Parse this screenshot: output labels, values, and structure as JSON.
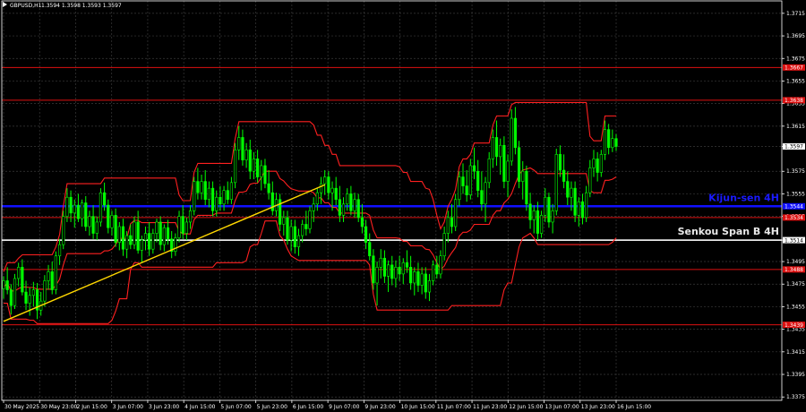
{
  "header": {
    "symbol": "GBPUSD,H1",
    "quote": "1.3594 1.3598 1.3593 1.3597"
  },
  "colors": {
    "background": "#000000",
    "grid": "#3a3a3a",
    "axis": "#ffffff",
    "candle": "#00ff00",
    "ichimoku": "#ff2020",
    "level": "#dd1010",
    "kijun_4h": "#1010ff",
    "senkou_4h": "#e8e8e8",
    "trendline": "#ffd700"
  },
  "chart_data": {
    "type": "candlestick",
    "symbol": "GBPUSD",
    "timeframe": "H1",
    "y_ticks": [
      "1.3715",
      "1.3695",
      "1.3675",
      "1.3655",
      "1.3635",
      "1.3615",
      "1.3597",
      "1.3575",
      "1.3555",
      "1.3535",
      "1.3514",
      "1.3495",
      "1.3475",
      "1.3455",
      "1.3435",
      "1.3415",
      "1.3395",
      "1.3375"
    ],
    "x_ticks": [
      "30 May 2025",
      "30 May 23:00",
      "2 Jun 15:00",
      "3 Jun 07:00",
      "3 Jun 23:00",
      "4 Jun 15:00",
      "5 Jun 07:00",
      "5 Jun 23:00",
      "6 Jun 15:00",
      "9 Jun 07:00",
      "9 Jun 23:00",
      "10 Jun 15:00",
      "11 Jun 07:00",
      "11 Jun 23:00",
      "12 Jun 15:00",
      "13 Jun 07:00",
      "13 Jun 23:00",
      "16 Jun 15:00"
    ],
    "ylim": [
      1.3372,
      1.3726
    ],
    "current_price": "1.3597",
    "levels": [
      {
        "price": 1.3667,
        "label": "1.3667",
        "kind": "support-resistance"
      },
      {
        "price": 1.3638,
        "label": "1.3638",
        "kind": "support-resistance"
      },
      {
        "price": 1.3544,
        "label": "1.3544",
        "kind": "kijun-4h",
        "name": "Kijun-sen 4H"
      },
      {
        "price": 1.3534,
        "label": "1.3534",
        "kind": "support-resistance"
      },
      {
        "price": 1.3514,
        "label": "1.3514",
        "kind": "senkou-b-4h",
        "name": "Senkou Span B 4H"
      },
      {
        "price": 1.3488,
        "label": "1.3488",
        "kind": "support-resistance"
      },
      {
        "price": 1.3439,
        "label": "1.3439",
        "kind": "support-resistance"
      }
    ],
    "trendline": {
      "from": {
        "bar": 0,
        "price": 1.3442
      },
      "to": {
        "bar": 86,
        "price": 1.3563
      }
    },
    "candles": [
      [
        1.3471,
        1.3482,
        1.3462,
        1.3478
      ],
      [
        1.3478,
        1.349,
        1.3466,
        1.347
      ],
      [
        1.347,
        1.3475,
        1.3448,
        1.3456
      ],
      [
        1.3456,
        1.3484,
        1.3453,
        1.348
      ],
      [
        1.348,
        1.3494,
        1.3473,
        1.349
      ],
      [
        1.349,
        1.3497,
        1.3465,
        1.3468
      ],
      [
        1.3468,
        1.3478,
        1.3452,
        1.3458
      ],
      [
        1.3458,
        1.3472,
        1.3447,
        1.3465
      ],
      [
        1.3465,
        1.3477,
        1.3455,
        1.347
      ],
      [
        1.347,
        1.3476,
        1.3444,
        1.3452
      ],
      [
        1.3452,
        1.3468,
        1.3447,
        1.346
      ],
      [
        1.346,
        1.3483,
        1.3455,
        1.3478
      ],
      [
        1.3478,
        1.3492,
        1.347,
        1.3486
      ],
      [
        1.3486,
        1.3495,
        1.3466,
        1.347
      ],
      [
        1.347,
        1.3504,
        1.3466,
        1.35
      ],
      [
        1.35,
        1.3515,
        1.3492,
        1.351
      ],
      [
        1.351,
        1.354,
        1.3506,
        1.3535
      ],
      [
        1.3535,
        1.356,
        1.353,
        1.3552
      ],
      [
        1.3552,
        1.3558,
        1.353,
        1.3538
      ],
      [
        1.3538,
        1.355,
        1.3525,
        1.3545
      ],
      [
        1.3545,
        1.3555,
        1.353,
        1.3533
      ],
      [
        1.3533,
        1.355,
        1.3526,
        1.3547
      ],
      [
        1.3547,
        1.3553,
        1.3522,
        1.3526
      ],
      [
        1.3526,
        1.354,
        1.3518,
        1.3535
      ],
      [
        1.3535,
        1.3545,
        1.3515,
        1.352
      ],
      [
        1.352,
        1.3535,
        1.3514,
        1.353
      ],
      [
        1.353,
        1.356,
        1.3526,
        1.3556
      ],
      [
        1.3556,
        1.3565,
        1.354,
        1.3545
      ],
      [
        1.3545,
        1.355,
        1.352,
        1.3525
      ],
      [
        1.3525,
        1.354,
        1.3518,
        1.3536
      ],
      [
        1.3536,
        1.3542,
        1.3508,
        1.3512
      ],
      [
        1.3512,
        1.353,
        1.3505,
        1.3526
      ],
      [
        1.3526,
        1.3533,
        1.35,
        1.3506
      ],
      [
        1.3506,
        1.3522,
        1.3498,
        1.3518
      ],
      [
        1.3518,
        1.3528,
        1.3506,
        1.351
      ],
      [
        1.351,
        1.3535,
        1.3506,
        1.353
      ],
      [
        1.353,
        1.354,
        1.3502,
        1.3505
      ],
      [
        1.3505,
        1.3518,
        1.3494,
        1.3514
      ],
      [
        1.3514,
        1.3526,
        1.3505,
        1.352
      ],
      [
        1.352,
        1.353,
        1.35,
        1.3506
      ],
      [
        1.3506,
        1.3524,
        1.3502,
        1.352
      ],
      [
        1.352,
        1.3533,
        1.3512,
        1.353
      ],
      [
        1.353,
        1.3535,
        1.3505,
        1.351
      ],
      [
        1.351,
        1.3528,
        1.3504,
        1.3525
      ],
      [
        1.3525,
        1.3532,
        1.351,
        1.3515
      ],
      [
        1.3515,
        1.3522,
        1.3498,
        1.3504
      ],
      [
        1.3504,
        1.352,
        1.35,
        1.3516
      ],
      [
        1.3516,
        1.354,
        1.3512,
        1.3535
      ],
      [
        1.3535,
        1.3545,
        1.3515,
        1.352
      ],
      [
        1.352,
        1.3534,
        1.3514,
        1.353
      ],
      [
        1.353,
        1.3545,
        1.3524,
        1.354
      ],
      [
        1.354,
        1.357,
        1.3536,
        1.3566
      ],
      [
        1.3566,
        1.3578,
        1.355,
        1.3556
      ],
      [
        1.3556,
        1.3572,
        1.355,
        1.3566
      ],
      [
        1.3566,
        1.3576,
        1.3545,
        1.355
      ],
      [
        1.355,
        1.3566,
        1.3543,
        1.356
      ],
      [
        1.356,
        1.3566,
        1.3535,
        1.354
      ],
      [
        1.354,
        1.3558,
        1.3535,
        1.3552
      ],
      [
        1.3552,
        1.3562,
        1.354,
        1.3546
      ],
      [
        1.3546,
        1.3562,
        1.354,
        1.3558
      ],
      [
        1.3558,
        1.3566,
        1.3546,
        1.355
      ],
      [
        1.355,
        1.357,
        1.3546,
        1.3565
      ],
      [
        1.3565,
        1.36,
        1.356,
        1.3594
      ],
      [
        1.3594,
        1.3615,
        1.3585,
        1.3605
      ],
      [
        1.3605,
        1.3612,
        1.358,
        1.3585
      ],
      [
        1.3585,
        1.36,
        1.3578,
        1.3594
      ],
      [
        1.3594,
        1.3603,
        1.3568,
        1.3575
      ],
      [
        1.3575,
        1.3592,
        1.3568,
        1.3586
      ],
      [
        1.3586,
        1.3594,
        1.3565,
        1.357
      ],
      [
        1.357,
        1.3585,
        1.3558,
        1.358
      ],
      [
        1.358,
        1.3586,
        1.356,
        1.3564
      ],
      [
        1.3564,
        1.3576,
        1.355,
        1.3556
      ],
      [
        1.3556,
        1.3566,
        1.3536,
        1.354
      ],
      [
        1.354,
        1.3556,
        1.3535,
        1.355
      ],
      [
        1.355,
        1.3555,
        1.3522,
        1.3528
      ],
      [
        1.3528,
        1.354,
        1.3518,
        1.3534
      ],
      [
        1.3534,
        1.354,
        1.351,
        1.3514
      ],
      [
        1.3514,
        1.3532,
        1.3504,
        1.3526
      ],
      [
        1.3526,
        1.3532,
        1.3502,
        1.3508
      ],
      [
        1.3508,
        1.3524,
        1.35,
        1.3518
      ],
      [
        1.3518,
        1.3532,
        1.3512,
        1.3528
      ],
      [
        1.3528,
        1.354,
        1.3518,
        1.3524
      ],
      [
        1.3524,
        1.3544,
        1.352,
        1.354
      ],
      [
        1.354,
        1.3552,
        1.353,
        1.3546
      ],
      [
        1.3546,
        1.356,
        1.354,
        1.3556
      ],
      [
        1.3556,
        1.357,
        1.3546,
        1.3564
      ],
      [
        1.3564,
        1.3576,
        1.3554,
        1.357
      ],
      [
        1.357,
        1.3575,
        1.355,
        1.3556
      ],
      [
        1.3556,
        1.3566,
        1.354,
        1.356
      ],
      [
        1.356,
        1.357,
        1.3545,
        1.355
      ],
      [
        1.355,
        1.3562,
        1.353,
        1.3536
      ],
      [
        1.3536,
        1.3552,
        1.353,
        1.3546
      ],
      [
        1.3546,
        1.356,
        1.354,
        1.3555
      ],
      [
        1.3555,
        1.3562,
        1.3536,
        1.354
      ],
      [
        1.354,
        1.3556,
        1.3534,
        1.355
      ],
      [
        1.355,
        1.3555,
        1.353,
        1.3534
      ],
      [
        1.3534,
        1.3546,
        1.352,
        1.3526
      ],
      [
        1.3526,
        1.3532,
        1.3506,
        1.3512
      ],
      [
        1.3512,
        1.352,
        1.3496,
        1.35
      ],
      [
        1.35,
        1.3506,
        1.347,
        1.3476
      ],
      [
        1.3476,
        1.3495,
        1.3456,
        1.349
      ],
      [
        1.349,
        1.3506,
        1.348,
        1.3498
      ],
      [
        1.3498,
        1.3505,
        1.3476,
        1.3482
      ],
      [
        1.3482,
        1.3496,
        1.3468,
        1.3492
      ],
      [
        1.3492,
        1.35,
        1.3474,
        1.348
      ],
      [
        1.348,
        1.3496,
        1.3472,
        1.349
      ],
      [
        1.349,
        1.35,
        1.3478,
        1.3484
      ],
      [
        1.3484,
        1.3498,
        1.3475,
        1.3494
      ],
      [
        1.3494,
        1.3505,
        1.3485,
        1.349
      ],
      [
        1.349,
        1.35,
        1.347,
        1.3476
      ],
      [
        1.3476,
        1.349,
        1.3465,
        1.3486
      ],
      [
        1.3486,
        1.3494,
        1.3468,
        1.3474
      ],
      [
        1.3474,
        1.349,
        1.3466,
        1.3484
      ],
      [
        1.3484,
        1.349,
        1.3462,
        1.3468
      ],
      [
        1.3468,
        1.3484,
        1.346,
        1.3478
      ],
      [
        1.3478,
        1.3496,
        1.3474,
        1.3492
      ],
      [
        1.3492,
        1.35,
        1.348,
        1.3484
      ],
      [
        1.3484,
        1.3505,
        1.348,
        1.35
      ],
      [
        1.35,
        1.3526,
        1.3496,
        1.352
      ],
      [
        1.352,
        1.354,
        1.3512,
        1.3534
      ],
      [
        1.3534,
        1.3546,
        1.352,
        1.3526
      ],
      [
        1.3526,
        1.3555,
        1.3522,
        1.355
      ],
      [
        1.355,
        1.3575,
        1.3544,
        1.357
      ],
      [
        1.357,
        1.3582,
        1.3555,
        1.3562
      ],
      [
        1.3562,
        1.3576,
        1.3548,
        1.3554
      ],
      [
        1.3554,
        1.3586,
        1.355,
        1.358
      ],
      [
        1.358,
        1.3596,
        1.3568,
        1.3575
      ],
      [
        1.3575,
        1.3585,
        1.3552,
        1.3558
      ],
      [
        1.3558,
        1.3575,
        1.354,
        1.3546
      ],
      [
        1.3546,
        1.357,
        1.353,
        1.3565
      ],
      [
        1.3565,
        1.3592,
        1.356,
        1.3586
      ],
      [
        1.3586,
        1.3612,
        1.3578,
        1.3605
      ],
      [
        1.3605,
        1.362,
        1.358,
        1.3588
      ],
      [
        1.3588,
        1.3604,
        1.3572,
        1.3598
      ],
      [
        1.3598,
        1.3606,
        1.356,
        1.3566
      ],
      [
        1.3566,
        1.359,
        1.3552,
        1.3584
      ],
      [
        1.3584,
        1.363,
        1.358,
        1.3622
      ],
      [
        1.3622,
        1.3632,
        1.359,
        1.3596
      ],
      [
        1.3596,
        1.3602,
        1.356,
        1.3566
      ],
      [
        1.3566,
        1.3584,
        1.355,
        1.3575
      ],
      [
        1.3575,
        1.358,
        1.354,
        1.3546
      ],
      [
        1.3546,
        1.3556,
        1.3524,
        1.3532
      ],
      [
        1.3532,
        1.3545,
        1.352,
        1.354
      ],
      [
        1.354,
        1.3548,
        1.3514,
        1.352
      ],
      [
        1.352,
        1.354,
        1.3516,
        1.3536
      ],
      [
        1.3536,
        1.356,
        1.353,
        1.3552
      ],
      [
        1.3552,
        1.3556,
        1.3525,
        1.353
      ],
      [
        1.353,
        1.3546,
        1.352,
        1.354
      ],
      [
        1.354,
        1.3595,
        1.3536,
        1.359
      ],
      [
        1.359,
        1.3598,
        1.357,
        1.3576
      ],
      [
        1.3576,
        1.359,
        1.356,
        1.3566
      ],
      [
        1.3566,
        1.3575,
        1.3545,
        1.3552
      ],
      [
        1.3552,
        1.3566,
        1.354,
        1.356
      ],
      [
        1.356,
        1.3566,
        1.353,
        1.3536
      ],
      [
        1.3536,
        1.3552,
        1.3526,
        1.3548
      ],
      [
        1.3548,
        1.3555,
        1.3528,
        1.3534
      ],
      [
        1.3534,
        1.3562,
        1.353,
        1.3556
      ],
      [
        1.3556,
        1.3585,
        1.3552,
        1.3578
      ],
      [
        1.3578,
        1.3594,
        1.357,
        1.3586
      ],
      [
        1.3586,
        1.3592,
        1.3566,
        1.3574
      ],
      [
        1.3574,
        1.3594,
        1.357,
        1.359
      ],
      [
        1.359,
        1.362,
        1.3585,
        1.3612
      ],
      [
        1.3612,
        1.3617,
        1.359,
        1.3596
      ],
      [
        1.3596,
        1.3612,
        1.3592,
        1.3604
      ],
      [
        1.3604,
        1.3608,
        1.3593,
        1.3597
      ]
    ]
  }
}
